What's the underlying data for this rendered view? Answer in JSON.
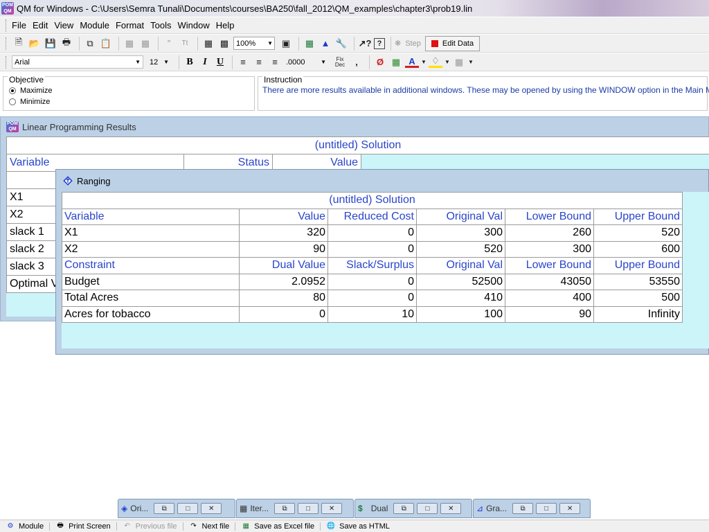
{
  "window": {
    "title": "QM for Windows - C:\\Users\\Semra Tunali\\Documents\\courses\\BA250\\fall_2012\\QM_examples\\chapter3\\prob19.lin",
    "icon_text": "POM QM"
  },
  "menu": [
    "File",
    "Edit",
    "View",
    "Module",
    "Format",
    "Tools",
    "Window",
    "Help"
  ],
  "toolbar": {
    "zoom": "100%",
    "step_label": "Step",
    "edit_data_label": "Edit Data"
  },
  "format_toolbar": {
    "font": "Arial",
    "size": "12",
    "number_format": ".0000",
    "fix_dec": "Fix Dec"
  },
  "objective": {
    "legend": "Objective",
    "options": [
      "Maximize",
      "Minimize"
    ],
    "selected": "Maximize"
  },
  "instruction": {
    "legend": "Instruction",
    "text": "There are more results available in additional windows. These may be opened by using the WINDOW option in the Main Menu."
  },
  "lp_results": {
    "title": "Linear Programming Results",
    "solution_header": "(untitled) Solution",
    "columns": [
      "Variable",
      "Status",
      "Value"
    ],
    "rows": [
      "X1",
      "X2",
      "slack 1",
      "slack 2",
      "slack 3",
      "Optimal V"
    ]
  },
  "ranging": {
    "title": "Ranging",
    "solution_header": "(untitled) Solution",
    "var_headers": [
      "Variable",
      "Value",
      "Reduced Cost",
      "Original Val",
      "Lower Bound",
      "Upper Bound"
    ],
    "var_rows": [
      [
        "X1",
        "320",
        "0",
        "300",
        "260",
        "520"
      ],
      [
        "X2",
        "90",
        "0",
        "520",
        "300",
        "600"
      ]
    ],
    "con_headers": [
      "Constraint",
      "Dual Value",
      "Slack/Surplus",
      "Original Val",
      "Lower Bound",
      "Upper Bound"
    ],
    "con_rows": [
      [
        "Budget",
        "2.0952",
        "0",
        "52500",
        "43050",
        "53550"
      ],
      [
        "Total Acres",
        "80",
        "0",
        "410",
        "400",
        "500"
      ],
      [
        "Acres for tobacco",
        "0",
        "10",
        "100",
        "90",
        "Infinity"
      ]
    ]
  },
  "minimized": [
    "Ori...",
    "Iter...",
    "Dual",
    "Gra..."
  ],
  "bottom_toolbar": [
    "Module",
    "Print Screen",
    "Previous file",
    "Next file",
    "Save as Excel file",
    "Save as HTML"
  ]
}
